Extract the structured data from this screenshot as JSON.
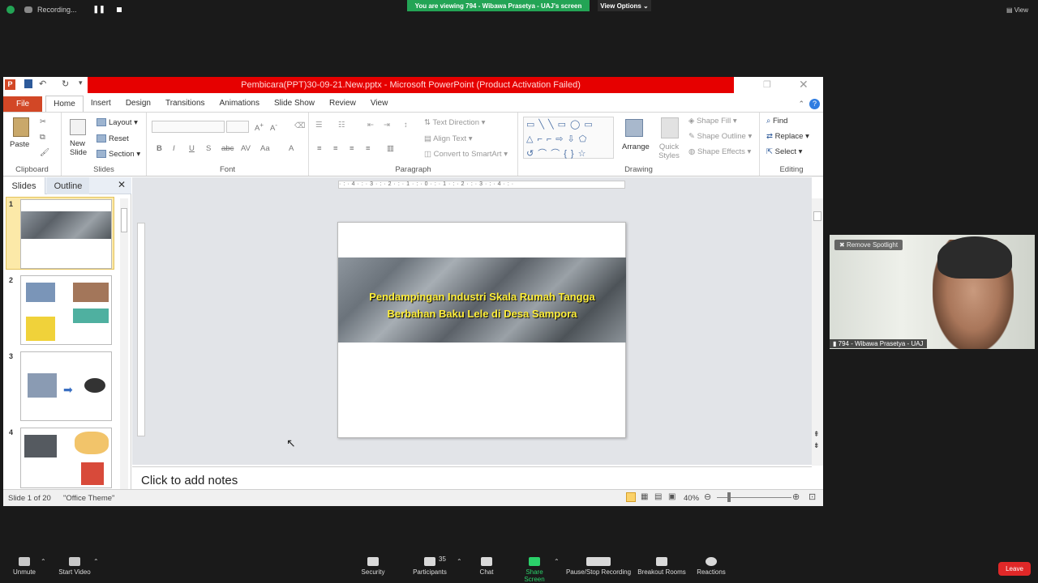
{
  "zoom": {
    "recording_label": "Recording...",
    "viewing_banner": "You are viewing 794 - Wibawa Prasetya - UAJ's screen",
    "view_options": "View Options",
    "view_label": "View",
    "video": {
      "remove_spotlight": "Remove Spotlight",
      "name": "794 - Wibawa Prasetya - UAJ"
    },
    "toolbar": {
      "unmute": "Unmute",
      "start_video": "Start Video",
      "security": "Security",
      "participants": "Participants",
      "participants_count": "35",
      "chat": "Chat",
      "share_screen": "Share Screen",
      "pause_recording": "Pause/Stop Recording",
      "breakout_rooms": "Breakout Rooms",
      "reactions": "Reactions",
      "leave": "Leave"
    }
  },
  "ppt": {
    "title": "Pembicara(PPT)30-09-21.New.pptx - Microsoft PowerPoint (Product Activation Failed)",
    "tabs": [
      "File",
      "Home",
      "Insert",
      "Design",
      "Transitions",
      "Animations",
      "Slide Show",
      "Review",
      "View"
    ],
    "ribbon": {
      "clipboard": {
        "paste": "Paste",
        "label": "Clipboard"
      },
      "slides": {
        "new_slide": "New Slide",
        "layout": "Layout",
        "reset": "Reset",
        "section": "Section",
        "label": "Slides"
      },
      "font": {
        "label": "Font"
      },
      "paragraph": {
        "text_direction": "Text Direction",
        "align_text": "Align Text",
        "convert_smartart": "Convert to SmartArt",
        "label": "Paragraph"
      },
      "drawing": {
        "arrange": "Arrange",
        "quick_styles": "Quick Styles",
        "shape_fill": "Shape Fill",
        "shape_outline": "Shape Outline",
        "shape_effects": "Shape Effects",
        "label": "Drawing"
      },
      "editing": {
        "find": "Find",
        "replace": "Replace",
        "select": "Select",
        "label": "Editing"
      }
    },
    "pane_tabs": {
      "slides": "Slides",
      "outline": "Outline"
    },
    "thumbnails": [
      "1",
      "2",
      "3",
      "4"
    ],
    "slide": {
      "title_line1": "Pendampingan Industri Skala Rumah Tangga",
      "title_line2": "Berbahan Baku Lele di Desa Sampora"
    },
    "notes_placeholder": "Click to add notes",
    "status": {
      "slide_position": "Slide 1 of 20",
      "theme": "\"Office Theme\"",
      "zoom": "40%"
    }
  }
}
